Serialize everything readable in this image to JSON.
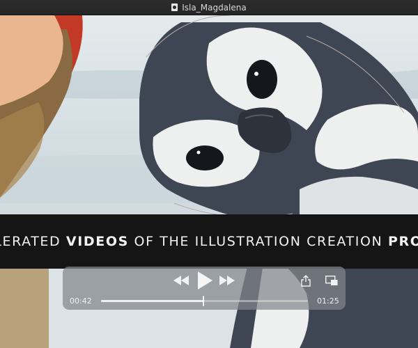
{
  "window": {
    "title": "Isla_Magdalena"
  },
  "overlay": {
    "caption_parts": [
      {
        "text": "ACCELERATED ",
        "weight": "light"
      },
      {
        "text": "VIDEOS",
        "weight": "bold"
      },
      {
        "text": " OF THE ILLUSTRATION CREATION ",
        "weight": "light"
      },
      {
        "text": "PROCESS",
        "weight": "bold"
      }
    ]
  },
  "player": {
    "current_time": "00:42",
    "total_time": "01:25",
    "progress": 0.494,
    "icons": {
      "rewind": "rewind-icon",
      "play": "play-icon",
      "fast_forward": "fast-forward-icon",
      "share": "share-icon",
      "picture_in_picture": "picture-in-picture-icon"
    }
  },
  "colors": {
    "caption_band": "#151515",
    "controls_bg": "#82868c",
    "penguin_dark": "#3e4654",
    "penguin_light": "#eef0f0",
    "background_sky": "#d3dde1",
    "hat_red": "#c23a26",
    "hair_brown": "#8a6a42"
  }
}
